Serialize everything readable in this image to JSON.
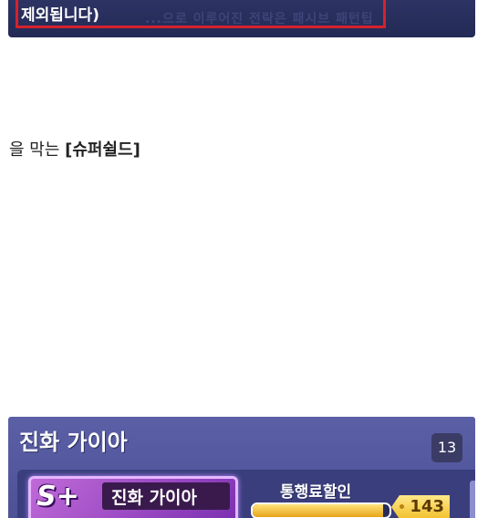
{
  "top_panel": {
    "notice_text": "제외됩니다)",
    "faded_text": "...으로 이루어진 전략은 패시브 패턴팁"
  },
  "sentence": {
    "prefix": "을 막는 ",
    "highlight": "[슈퍼쉴드]"
  },
  "bottom_panel": {
    "title": "진화 가이아",
    "count": "13",
    "card": {
      "rank": "S+",
      "name": "진화 가이아"
    },
    "discount_label": "통행료할인",
    "discount_progress": 0.95,
    "discount_value": "143"
  }
}
